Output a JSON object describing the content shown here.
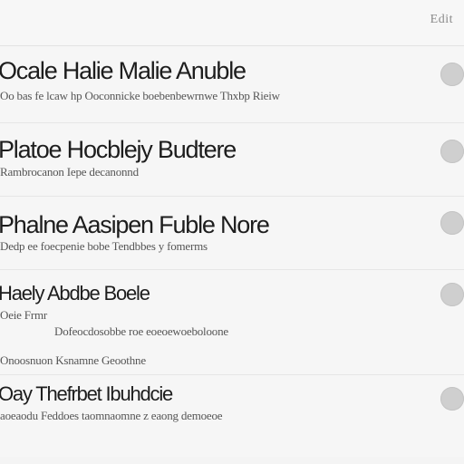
{
  "header": {
    "action_label": "Edit"
  },
  "rows": [
    {
      "title": "Ocale Halie Malie Anuble",
      "subtitle": "Oo bas fe lcaw hp Ooconnicke boebenbewrnwe Thxbp Rieiw"
    },
    {
      "title": "Platoe Hocblejy Budtere",
      "subtitle": "Rambrocanon Iepe decanonnd"
    },
    {
      "title": "Phalne Aasipen Fuble Nore",
      "subtitle": "Dedp ee foecpenie bobe Tendbbes y fomerms"
    },
    {
      "title": "Haely Abdbe Boele",
      "subtitle": "Oeie Frmr",
      "subtitle2": "Dofeocdosobbe roe eoeoewoeboloone",
      "subtitle3": "Onoosnuon Ksnamne Geoothne"
    },
    {
      "title": "Oay Thefrbet Ibuhdcie",
      "subtitle": "aoeaodu Feddoes taomnaomne z eaong demoeoe"
    }
  ]
}
